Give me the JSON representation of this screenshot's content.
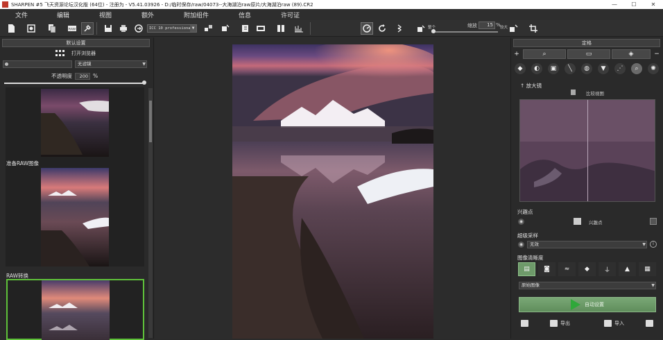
{
  "window": {
    "title": "SHARPEN #5 飞天资源论坛汉化版 (64位) - 注册为 - V5.41.03926 - D:/临时保存/raw/04073--大海湖泊raw原片/大海湖泊raw (89).CR2",
    "minimize": "—",
    "maximize": "☐",
    "close": "✕"
  },
  "menu": [
    "文件",
    "编辑",
    "视图",
    "额外",
    "附加组件",
    "信息",
    "许可证"
  ],
  "toolbar": {
    "profile_select": "ICC 10 professional",
    "zoom_label": "缩放",
    "zoom_value": "15",
    "zoom_unit": "%",
    "zoom_small_label": "整个",
    "zoom_small_label2": "较大"
  },
  "left_panel": {
    "header": "默认设置",
    "open_browser": "打开浏览器",
    "filter_select": "无滤镜",
    "opacity_label": "不透明度",
    "opacity_value": "200",
    "opacity_unit": "%",
    "presets": [
      {
        "label": ""
      },
      {
        "label": "准备RAW图像"
      },
      {
        "label": "RAW转换"
      }
    ]
  },
  "right_panel": {
    "header": "定格",
    "loupe_title": "放大镜",
    "compare_label": "比较视图",
    "focus_section": "兴趣点",
    "focus_item": "兴趣点",
    "supersample_section": "超级采样",
    "supersample_value": "无效",
    "sharpness_section": "图像清晰度",
    "sharpness_select": "原始图像",
    "auto_button": "自动设置",
    "export_label": "导出",
    "import_label": "导入"
  },
  "colors": {
    "accent_green": "#5fc23a",
    "auto_green": "#6e9a6a",
    "panel_bg": "#2a2a2a"
  }
}
